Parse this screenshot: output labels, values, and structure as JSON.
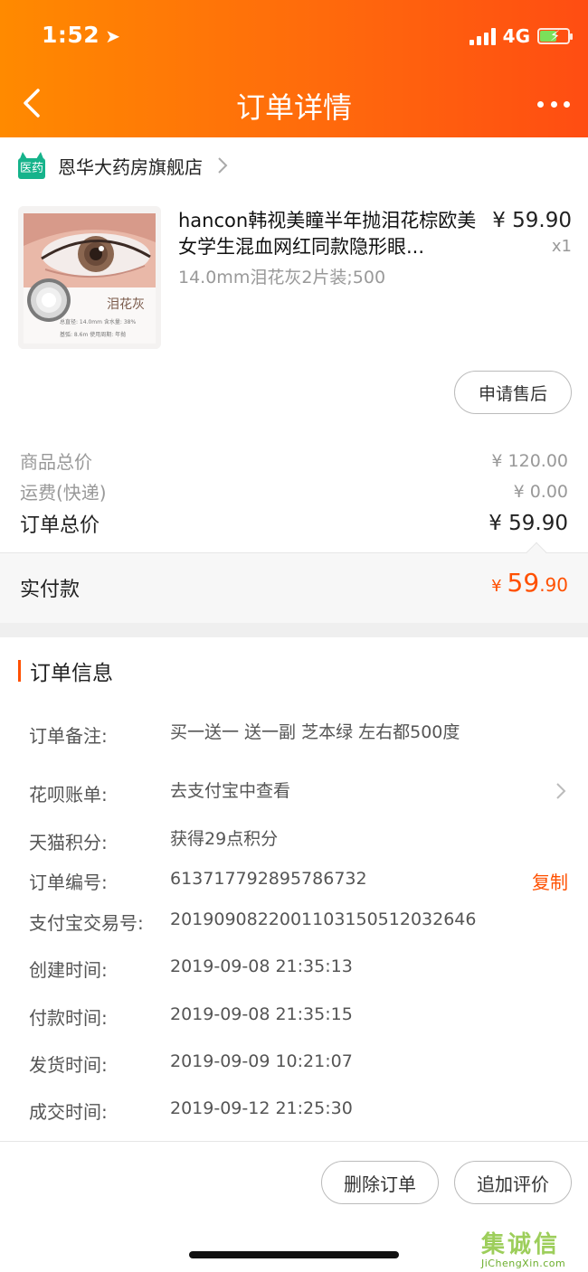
{
  "status_bar": {
    "time": "1:52",
    "network": "4G"
  },
  "header": {
    "title": "订单详情"
  },
  "store": {
    "logo_text": "医药",
    "name": "恩华大药房旗舰店"
  },
  "product": {
    "title": "hancon韩视美瞳半年抛泪花棕欧美女学生混血网红同款隐形眼...",
    "sku": "14.0mm泪花灰2片装;500",
    "price": "¥ 59.90",
    "quantity": "x1",
    "image_label": "泪花灰",
    "image_spec_1": "总直径: 14.0mm  含水量: 38%",
    "image_spec_2": "基弧: 8.6m   使用周期: 年抛",
    "after_sale_label": "申请售后"
  },
  "summary": {
    "goods_total_label": "商品总价",
    "goods_total_value": "¥ 120.00",
    "shipping_label": "运费(快递)",
    "shipping_value": "¥ 0.00",
    "order_total_label": "订单总价",
    "order_total_value": "¥ 59.90",
    "paid_label": "实付款",
    "paid_currency": "¥",
    "paid_integer": "59",
    "paid_decimal": ".90"
  },
  "order_info": {
    "section_title": "订单信息",
    "remark_label": "订单备注:",
    "remark_value": "买一送一 送一副 芝本绿 左右都500度",
    "huabei_label": "花呗账单:",
    "huabei_value": "去支付宝中查看",
    "points_label": "天猫积分:",
    "points_value": "获得29点积分",
    "order_no_label": "订单编号:",
    "order_no_value": "613717792895786732",
    "copy_label": "复制",
    "alipay_no_label": "支付宝交易号:",
    "alipay_no_value": "2019090822001103150512032646",
    "created_label": "创建时间:",
    "created_value": "2019-09-08 21:35:13",
    "paid_time_label": "付款时间:",
    "paid_time_value": "2019-09-08 21:35:15",
    "shipped_label": "发货时间:",
    "shipped_value": "2019-09-09 10:21:07",
    "completed_label": "成交时间:",
    "completed_value": "2019-09-12 21:25:30"
  },
  "actions": {
    "delete_label": "删除订单",
    "review_label": "追加评价"
  },
  "watermark": {
    "mark": "集诚信",
    "site": "JiChengXin.com"
  },
  "colors": {
    "header_start": "#ff8a00",
    "header_end": "#ff4d12",
    "accent": "#ff5000",
    "store_logo": "#16b38b"
  },
  "icons": [
    "location-arrow-icon",
    "signal-icon",
    "battery-icon",
    "back-arrow-icon",
    "more-dots-icon",
    "tmall-cat-icon",
    "chevron-right-icon"
  ]
}
